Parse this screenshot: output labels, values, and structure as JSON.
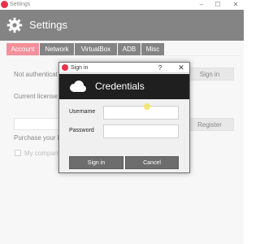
{
  "window": {
    "title": "Settings",
    "controls": {
      "minimize": "–",
      "maximize": "☐",
      "close": "✕"
    }
  },
  "header": {
    "title": "Settings",
    "icon": "gear-icon"
  },
  "tabs": [
    {
      "label": "Account",
      "active": true
    },
    {
      "label": "Network",
      "active": false
    },
    {
      "label": "VirtualBox",
      "active": false
    },
    {
      "label": "ADB",
      "active": false
    },
    {
      "label": "Misc",
      "active": false
    }
  ],
  "account": {
    "auth_status": "Not authenticat",
    "sign_in_button": "Sign in",
    "current_license_label": "Current license:",
    "register_button": "Register",
    "purchase_text": "Purchase your li",
    "company_checkbox_label": "My compan"
  },
  "dialog": {
    "title": "Sign in",
    "help": "?",
    "close": "✕",
    "header_title": "Credentials",
    "header_icon": "cloud-icon",
    "username_label": "Username",
    "password_label": "Password",
    "username_value": "",
    "password_value": "",
    "sign_in_button": "Sign in",
    "cancel_button": "Cancel"
  },
  "colors": {
    "accent": "#e8334a",
    "dark": "#1f1f1f",
    "button_gray": "#6d6d6d"
  }
}
